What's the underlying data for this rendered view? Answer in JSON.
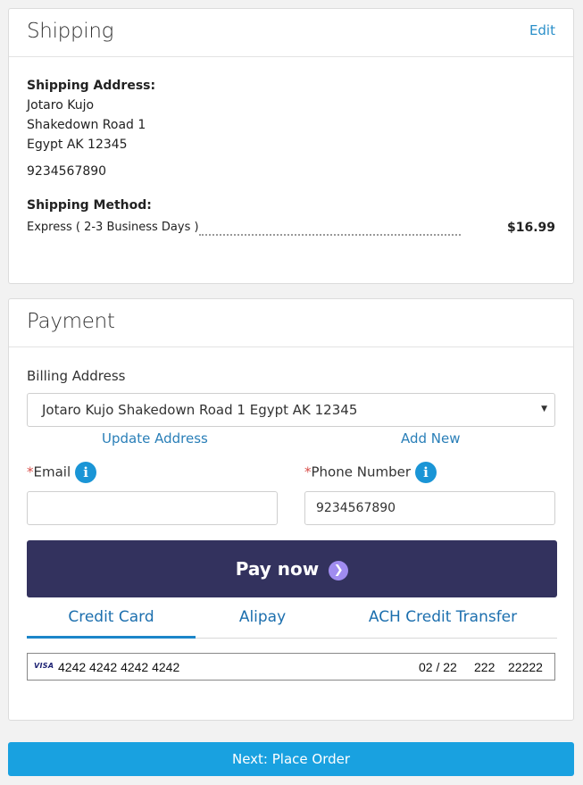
{
  "shipping": {
    "title": "Shipping",
    "edit_label": "Edit",
    "address_heading": "Shipping Address:",
    "name": "Jotaro Kujo",
    "street": "Shakedown Road 1",
    "city_line": "Egypt AK 12345",
    "phone": "9234567890",
    "method_heading": "Shipping Method:",
    "method_name": "Express ( 2-3 Business Days )",
    "method_price": "$16.99"
  },
  "payment": {
    "title": "Payment",
    "billing_label": "Billing Address",
    "billing_selected": "Jotaro Kujo Shakedown Road 1 Egypt AK 12345",
    "update_address_label": "Update Address",
    "add_new_label": "Add New",
    "email_required_mark": "*",
    "email_label": "Email",
    "email_value": "",
    "phone_required_mark": "*",
    "phone_label": "Phone Number",
    "phone_value": "9234567890",
    "info_glyph": "i",
    "pay_now_label": "Pay now",
    "pay_chevron": "❯",
    "tabs": [
      {
        "label": "Credit Card",
        "active": true
      },
      {
        "label": "Alipay",
        "active": false
      },
      {
        "label": "ACH Credit Transfer",
        "active": false
      }
    ],
    "card": {
      "brand": "VISA",
      "number": "4242 4242 4242 4242",
      "expiry": "02 / 22",
      "cvc": "222",
      "zip": "22222"
    }
  },
  "next_button_label": "Next: Place Order",
  "colors": {
    "accent": "#19a1e0",
    "pay_button": "#33325e",
    "link": "#2a7fb8",
    "required": "#d9534f"
  },
  "icons": [
    "info-icon",
    "chevron-right-icon",
    "dropdown-arrow-icon",
    "visa-card-icon"
  ]
}
